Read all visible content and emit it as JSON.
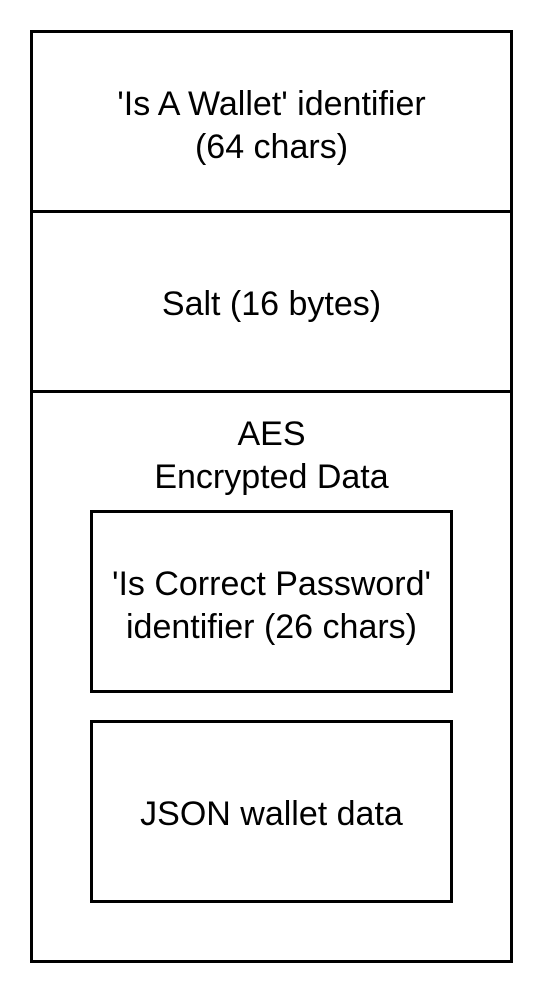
{
  "diagram": {
    "header_box": {
      "line1": "'Is A Wallet' identifier",
      "line2": "(64 chars)"
    },
    "salt_box": {
      "label": "Salt (16 bytes)"
    },
    "encrypted_box": {
      "line1": "AES",
      "line2": "Encrypted Data",
      "password_box": {
        "line1": "'Is Correct Password'",
        "line2": "identifier (26 chars)"
      },
      "json_box": {
        "label": "JSON wallet data"
      }
    }
  }
}
